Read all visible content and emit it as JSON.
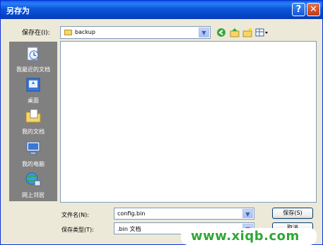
{
  "window": {
    "title": "另存为"
  },
  "titlebar_buttons": {
    "help": "?",
    "close": "✕"
  },
  "save_in": {
    "label": "保存在(I):",
    "value": "backup"
  },
  "places": [
    {
      "label": "我最近的文档",
      "icon": "recent-documents-icon"
    },
    {
      "label": "桌面",
      "icon": "desktop-icon"
    },
    {
      "label": "我的文档",
      "icon": "my-documents-icon"
    },
    {
      "label": "我的电脑",
      "icon": "my-computer-icon"
    },
    {
      "label": "网上邻居",
      "icon": "network-places-icon"
    }
  ],
  "file_name": {
    "label": "文件名(N):",
    "value": "config.bin"
  },
  "save_type": {
    "label": "保存类型(T):",
    "value": ".bin 文档"
  },
  "buttons": {
    "save": "保存(S)",
    "cancel": "取消"
  },
  "watermark": "www.xiqb.com",
  "colors": {
    "title_bar": "#0a56d8",
    "places_bar": "#808080",
    "watermark_green": "#2fa836"
  }
}
